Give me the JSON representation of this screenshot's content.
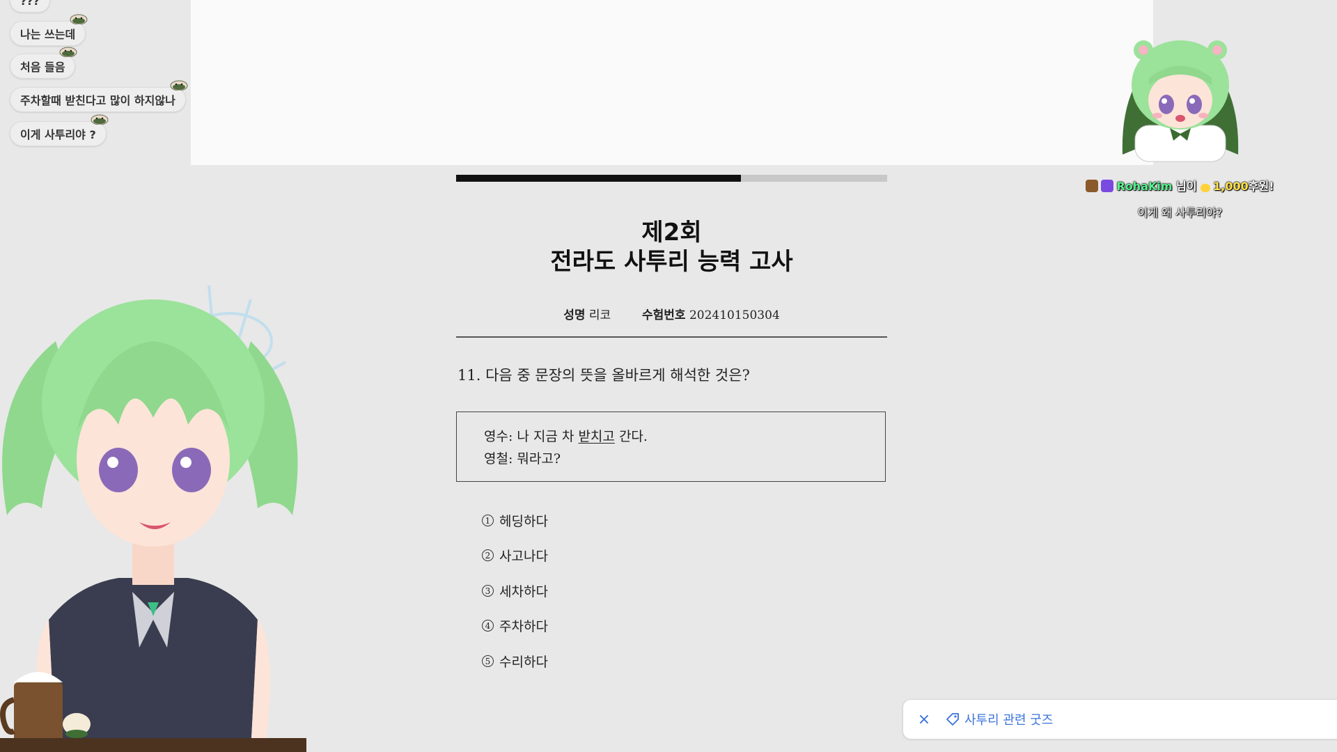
{
  "chat": {
    "messages": [
      {
        "text": "???"
      },
      {
        "text": "나는 쓰는데"
      },
      {
        "text": "처음 들음"
      },
      {
        "text": "주차할때 받친다고 많이 하지않나"
      },
      {
        "text": "이게 사투리야 ?"
      }
    ]
  },
  "exam": {
    "progress": 0.66,
    "title_line1": "제2회",
    "title_line2": "전라도 사투리 능력 고사",
    "name_label": "성명",
    "name_value": "리코",
    "id_label": "수험번호",
    "id_value": "202410150304",
    "question": "11. 다음 중 문장의 뜻을 올바르게 해석한 것은?",
    "dialog": {
      "line1_prefix": "영수: 나 지금 차 ",
      "line1_underlined": "받치고",
      "line1_suffix": " 간다.",
      "line2": "영철: 뭐라고?"
    },
    "options": [
      {
        "num": "1",
        "text": "헤딩하다"
      },
      {
        "num": "2",
        "text": "사고나다"
      },
      {
        "num": "3",
        "text": "세차하다"
      },
      {
        "num": "4",
        "text": "주차하다"
      },
      {
        "num": "5",
        "text": "수리하다"
      }
    ]
  },
  "donation": {
    "donor": "RohaKim",
    "suffix": " 님이 ",
    "amount": "1,000",
    "amount_suffix": "후원!",
    "message": "이게 왜 사투리야?"
  },
  "goods": {
    "close_icon": "×",
    "label": "사투리 관련 굿즈"
  },
  "colors": {
    "accent_blue": "#3a73d9",
    "donor_green": "#59f08f",
    "amount_yellow": "#ffe34a",
    "hair_green": "#9be29a"
  }
}
